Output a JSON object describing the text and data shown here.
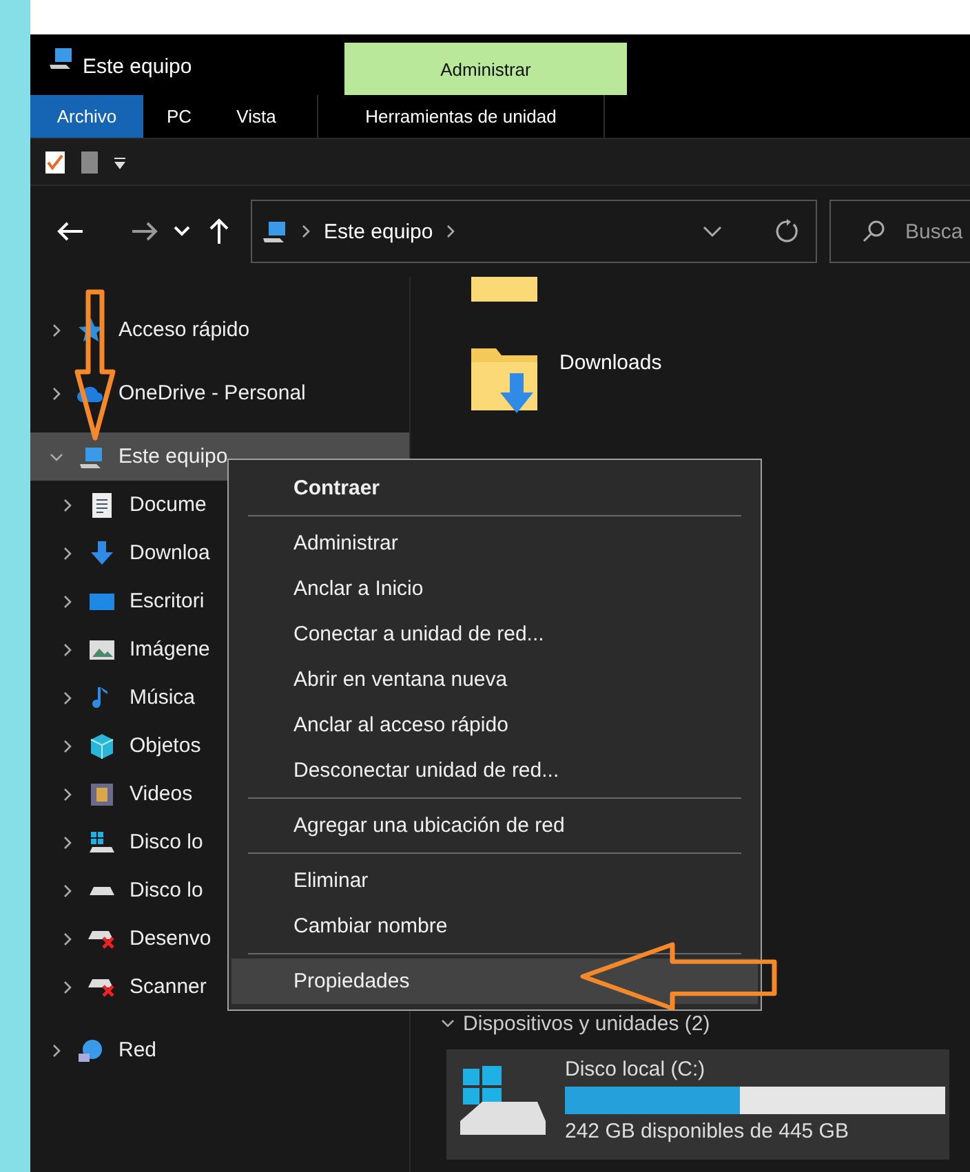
{
  "window": {
    "title": "Este equipo"
  },
  "ribbon": {
    "context_header": "Administrar",
    "tabs": [
      {
        "label": "Archivo",
        "selected": true
      },
      {
        "label": "PC",
        "selected": false
      },
      {
        "label": "Vista",
        "selected": false
      },
      {
        "label": "Herramientas de unidad",
        "selected": false
      }
    ]
  },
  "address_bar": {
    "path": "Este equipo"
  },
  "search": {
    "placeholder": "Busca"
  },
  "navigation": [
    {
      "kind": "star",
      "label": "Acceso rápido",
      "expanded": false,
      "selected": false
    },
    {
      "kind": "cloud",
      "label": "OneDrive - Personal",
      "expanded": false,
      "selected": false
    },
    {
      "kind": "pc",
      "label": "Este equipo",
      "expanded": true,
      "selected": true,
      "children": [
        {
          "kind": "document",
          "label": "Docume",
          "expanded": false,
          "selected": false
        },
        {
          "kind": "download",
          "label": "Downloa",
          "expanded": false,
          "selected": false
        },
        {
          "kind": "desktop",
          "label": "Escritori",
          "expanded": false,
          "selected": false
        },
        {
          "kind": "picture",
          "label": "Imágene",
          "expanded": false,
          "selected": false
        },
        {
          "kind": "music",
          "label": "Música",
          "expanded": false,
          "selected": false
        },
        {
          "kind": "cube",
          "label": "Objetos",
          "expanded": false,
          "selected": false
        },
        {
          "kind": "video",
          "label": "Videos",
          "expanded": false,
          "selected": false
        },
        {
          "kind": "windrive",
          "label": "Disco lo",
          "expanded": false,
          "selected": false
        },
        {
          "kind": "drive",
          "label": "Disco lo",
          "expanded": false,
          "selected": false
        },
        {
          "kind": "netdrive",
          "label": "Desenvo",
          "expanded": false,
          "selected": false
        },
        {
          "kind": "netdrive",
          "label": "Scanner",
          "expanded": false,
          "selected": false
        }
      ]
    },
    {
      "kind": "network",
      "label": "Red",
      "expanded": false,
      "selected": false
    }
  ],
  "folders": [
    {
      "label": "Downloads"
    }
  ],
  "devices": {
    "header": "Dispositivos y unidades (2)",
    "expanded": true,
    "drives": [
      {
        "name": "Disco local (C:)",
        "level": 0.46,
        "free": "242 GB disponibles de 445 GB"
      }
    ]
  },
  "context_menu": {
    "groups": [
      [
        {
          "label": "Contraer",
          "default": true,
          "selected": false
        }
      ],
      [
        {
          "label": "Administrar",
          "default": false,
          "selected": false
        },
        {
          "label": "Anclar a Inicio",
          "default": false,
          "selected": false
        },
        {
          "label": "Conectar a unidad de red...",
          "default": false,
          "selected": false
        },
        {
          "label": "Abrir en ventana nueva",
          "default": false,
          "selected": false
        },
        {
          "label": "Anclar al acceso rápido",
          "default": false,
          "selected": false
        },
        {
          "label": "Desconectar unidad de red...",
          "default": false,
          "selected": false
        }
      ],
      [
        {
          "label": "Agregar una ubicación de red",
          "default": false,
          "selected": false
        }
      ],
      [
        {
          "label": "Eliminar",
          "default": false,
          "selected": false
        },
        {
          "label": "Cambiar nombre",
          "default": false,
          "selected": false
        }
      ],
      [
        {
          "label": "Propiedades",
          "default": false,
          "selected": true
        }
      ]
    ]
  }
}
